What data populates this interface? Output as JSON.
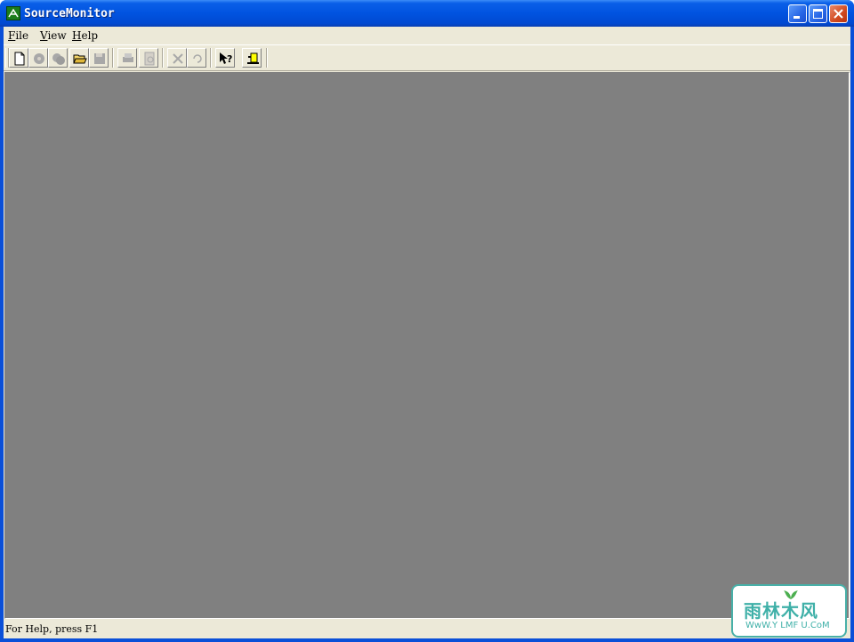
{
  "window": {
    "title": "SourceMonitor",
    "accent": "#0153e0",
    "workspace_color": "#808080"
  },
  "menu": {
    "items": [
      {
        "label": "File",
        "mnemonic": "F",
        "rest": "ile"
      },
      {
        "label": "View",
        "mnemonic": "V",
        "rest": "iew"
      },
      {
        "label": "Help",
        "mnemonic": "H",
        "rest": "elp"
      }
    ]
  },
  "toolbar": {
    "buttons": [
      {
        "icon": "new-document-icon",
        "enabled": true
      },
      {
        "icon": "gear-icon",
        "enabled": false
      },
      {
        "icon": "gears-icon",
        "enabled": false
      },
      {
        "icon": "open-folder-icon",
        "enabled": true
      },
      {
        "icon": "save-icon",
        "enabled": false
      },
      {
        "icon": "print-icon",
        "enabled": false
      },
      {
        "icon": "print-preview-icon",
        "enabled": false
      },
      {
        "icon": "delete-icon",
        "enabled": false
      },
      {
        "icon": "refresh-icon",
        "enabled": false
      },
      {
        "icon": "context-help-icon",
        "enabled": true
      },
      {
        "icon": "exit-door-icon",
        "enabled": true
      }
    ]
  },
  "status": {
    "text": "For Help, press F1"
  },
  "watermark": {
    "main": "雨林木风",
    "sub": "WwW.Y LMF U.CoM"
  }
}
